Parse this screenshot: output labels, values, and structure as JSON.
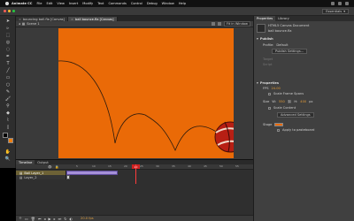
{
  "menubar": {
    "app": "Animate CC",
    "items": [
      "File",
      "Edit",
      "View",
      "Insert",
      "Modify",
      "Text",
      "Commands",
      "Control",
      "Debug",
      "Window",
      "Help"
    ]
  },
  "workspace": {
    "label": "Essentials"
  },
  "documents": {
    "tabs": [
      {
        "label": "bouncing ball.fla [Canvas]"
      },
      {
        "label": "ball bounce.fla [Canvas]"
      }
    ]
  },
  "editbar": {
    "scene": "Scene 1",
    "zoom": "Fit in Window"
  },
  "timeline": {
    "tabs": [
      "Timeline",
      "Output"
    ],
    "ruler": [
      "5",
      "10",
      "15",
      "20",
      "25",
      "30",
      "35",
      "40",
      "45",
      "50",
      "55"
    ],
    "playhead_frame": "20",
    "layers": [
      {
        "name": "Ball Layer_1"
      },
      {
        "name": "Layer_2"
      }
    ],
    "bottom": {
      "fps_readout": "20.0 fps"
    }
  },
  "properties": {
    "tabs": [
      "Properties",
      "Library"
    ],
    "doc_type": "HTML5 Canvas Document",
    "doc_name": "ball bounce.fla",
    "publish": {
      "header": "Publish",
      "profile_label": "Profile:",
      "profile_value": "Default",
      "settings_button": "Publish Settings...",
      "target_label": "Target",
      "script_label": "Script"
    },
    "properties": {
      "header": "Properties",
      "fps_label": "FPS",
      "fps_value": "24.00",
      "scale_label": "Scale Frame Spans",
      "size_label": "Size",
      "width_value": "550",
      "height_value": "400",
      "px": "px",
      "scale_content_label": "Scale Content",
      "advanced_button": "Advanced Settings",
      "stage_label": "Stage",
      "apply_label": "Apply to pasteboard"
    }
  },
  "colors": {
    "stage": "#ea6a07",
    "ball_red": "#b71f14",
    "tween": "#a590d8"
  }
}
